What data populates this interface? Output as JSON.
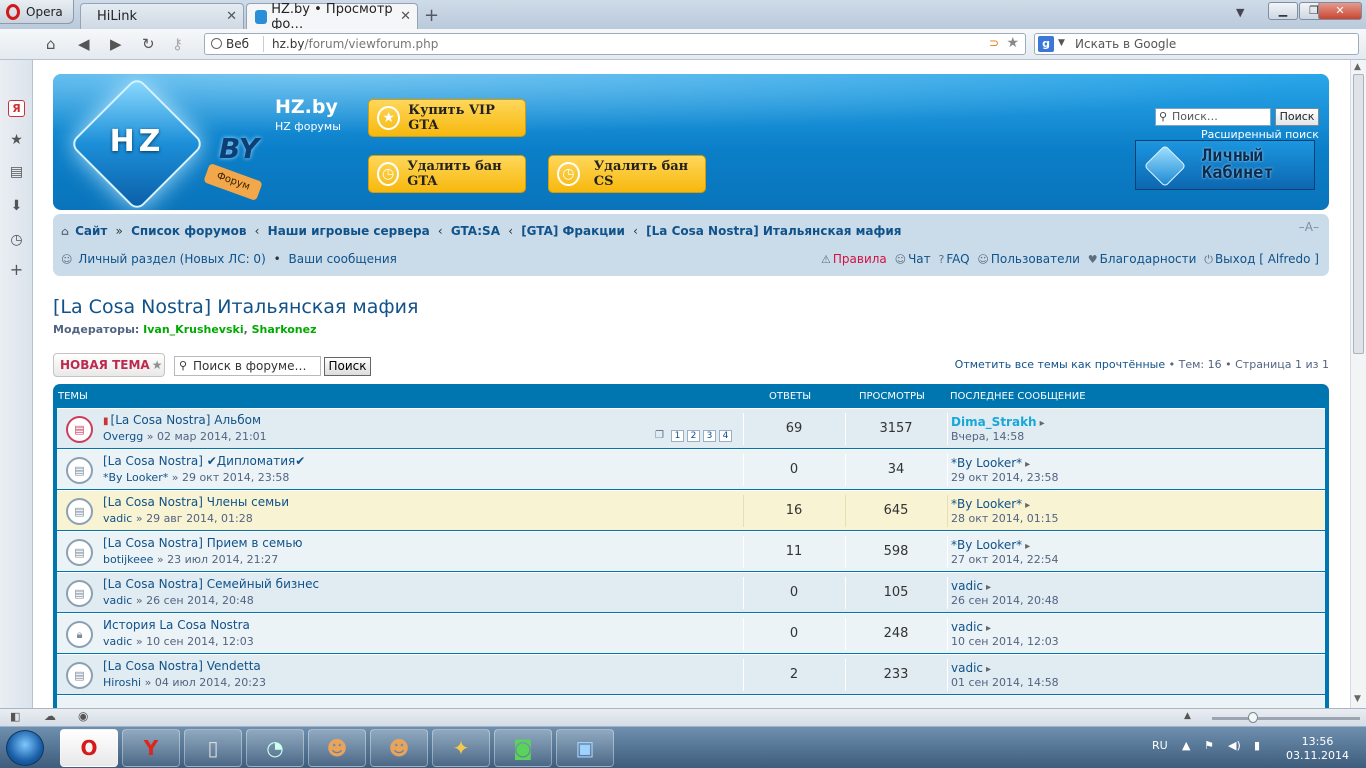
{
  "browser": {
    "menu_label": "Opera",
    "tabs": [
      {
        "title": "HiLink"
      },
      {
        "title": "HZ.by • Просмотр фо…"
      }
    ],
    "address": {
      "mode_label": "Веб",
      "host": "hz.by",
      "path": "/forum/viewforum.php"
    },
    "search": {
      "placeholder": "Искать в Google",
      "engine_letter": "g"
    }
  },
  "header": {
    "site_name": "HZ.by",
    "site_desc": "HZ форумы",
    "logo_letters": "HZ",
    "logo_suffix": "BY",
    "logo_tag": "Форум",
    "promo": [
      {
        "label": "Купить VIP GTA",
        "icon": "star-icon"
      },
      {
        "label": "Удалить бан GTA",
        "icon": "clock-icon"
      },
      {
        "label": "Удалить бан CS",
        "icon": "clock-icon"
      }
    ],
    "search_placeholder": "Поиск…",
    "search_button": "Поиск",
    "advanced_search": "Расширенный поиск",
    "cabinet_line1": "Личный",
    "cabinet_line2": "Кабинет"
  },
  "nav": {
    "breadcrumbs": [
      "Сайт",
      "Список форумов",
      "Наши игровые сервера",
      "GTA:SA",
      "[GTA] Фракции",
      "[La Cosa Nostra] Итальянская мафия"
    ],
    "font_size_label": "–A–",
    "private_messages": "Личный раздел (Новых ЛС: 0)",
    "your_posts": "Ваши сообщения",
    "quick": {
      "rules": "Правила",
      "chat": "Чат",
      "faq": "FAQ",
      "users": "Пользователи",
      "thanks": "Благодарности",
      "logout": "Выход [ Alfredo ]"
    }
  },
  "forum": {
    "title": "[La Cosa Nostra] Итальянская мафия",
    "moderators_label": "Модераторы:",
    "moderators": [
      "Ivan_Krushevski",
      "Sharkonez"
    ],
    "new_topic": "НОВАЯ ТЕМА",
    "search_placeholder": "Поиск в форуме…",
    "search_button": "Поиск",
    "mark_read": "Отметить все темы как прочтённые",
    "topics_count": "Тем: 16",
    "page_info": "Страница 1 из 1"
  },
  "table": {
    "headers": {
      "topics": "ТЕМЫ",
      "replies": "ОТВЕТЫ",
      "views": "ПРОСМОТРЫ",
      "last_post": "ПОСЛЕДНЕЕ СООБЩЕНИЕ"
    },
    "rows": [
      {
        "title": "[La Cosa Nostra] Альбом",
        "author": "Overgg",
        "date": "» 02 мар 2014, 21:01",
        "replies": "69",
        "views": "3157",
        "last_user": "Dima_Strakh",
        "last_date": "Вчера, 14:58",
        "pages": [
          "1",
          "2",
          "3",
          "4"
        ]
      },
      {
        "title": "[La Cosa Nostra] ✔Дипломатия✔",
        "author": "*By Looker*",
        "date": "» 29 окт 2014, 23:58",
        "replies": "0",
        "views": "34",
        "last_user": "*By Looker*",
        "last_date": "29 окт 2014, 23:58"
      },
      {
        "title": "[La Cosa Nostra] Члены семьи",
        "author": "vadic",
        "date": "» 29 авг 2014, 01:28",
        "replies": "16",
        "views": "645",
        "last_user": "*By Looker*",
        "last_date": "28 окт 2014, 01:15"
      },
      {
        "title": "[La Cosa Nostra] Прием в семью",
        "author": "botijkeee",
        "date": "» 23 июл 2014, 21:27",
        "replies": "11",
        "views": "598",
        "last_user": "*By Looker*",
        "last_date": "27 окт 2014, 22:54"
      },
      {
        "title": "[La Cosa Nostra] Семейный бизнес",
        "author": "vadic",
        "date": "» 26 сен 2014, 20:48",
        "replies": "0",
        "views": "105",
        "last_user": "vadic",
        "last_date": "26 сен 2014, 20:48"
      },
      {
        "title": "История La Cosa Nostra",
        "author": "vadic",
        "date": "» 10 сен 2014, 12:03",
        "replies": "0",
        "views": "248",
        "last_user": "vadic",
        "last_date": "10 сен 2014, 12:03"
      },
      {
        "title": "[La Cosa Nostra] Vendetta",
        "author": "Hiroshi",
        "date": "» 04 июл 2014, 20:23",
        "replies": "2",
        "views": "233",
        "last_user": "vadic",
        "last_date": "01 сен 2014, 14:58"
      }
    ]
  },
  "taskbar": {
    "lang": "RU",
    "time": "13:56",
    "date": "03.11.2014"
  }
}
